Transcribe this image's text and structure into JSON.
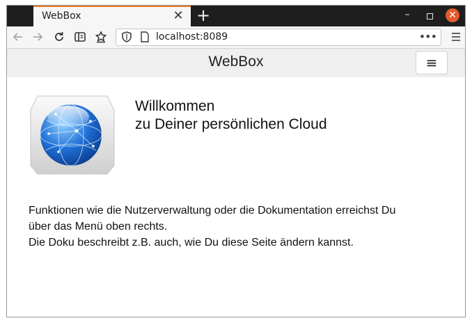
{
  "browser": {
    "tab": {
      "title": "WebBox",
      "close_glyph": "✕"
    },
    "newtab_glyph": "+",
    "window_controls": {
      "minimize": "–",
      "close": "✕"
    },
    "url": "localhost:8089",
    "more_glyph": "•••",
    "icons": {
      "back": "arrow-left-icon",
      "forward": "arrow-right-icon",
      "reload": "reload-icon",
      "reader": "reader-view-icon",
      "bookmark": "bookmark-star-icon",
      "shield": "tracking-shield-icon",
      "page": "page-icon",
      "menu": "hamburger-menu-icon"
    }
  },
  "page": {
    "header": {
      "title": "WebBox",
      "menu_glyph": "≡"
    },
    "welcome": {
      "line1": "Willkommen",
      "line2": "zu Deiner persönlichen Cloud"
    },
    "info": {
      "line1": "Funktionen wie die Nutzerverwaltung oder die Dokumentation erreichst Du",
      "line2": "über das Menü oben rechts.",
      "line3": "Die Doku beschreibt z.B. auch, wie Du diese Seite ändern kannst."
    },
    "colors": {
      "tab_accent": "#e8761a",
      "header_bg": "#efefef",
      "globe": "#1f6fd6"
    }
  }
}
